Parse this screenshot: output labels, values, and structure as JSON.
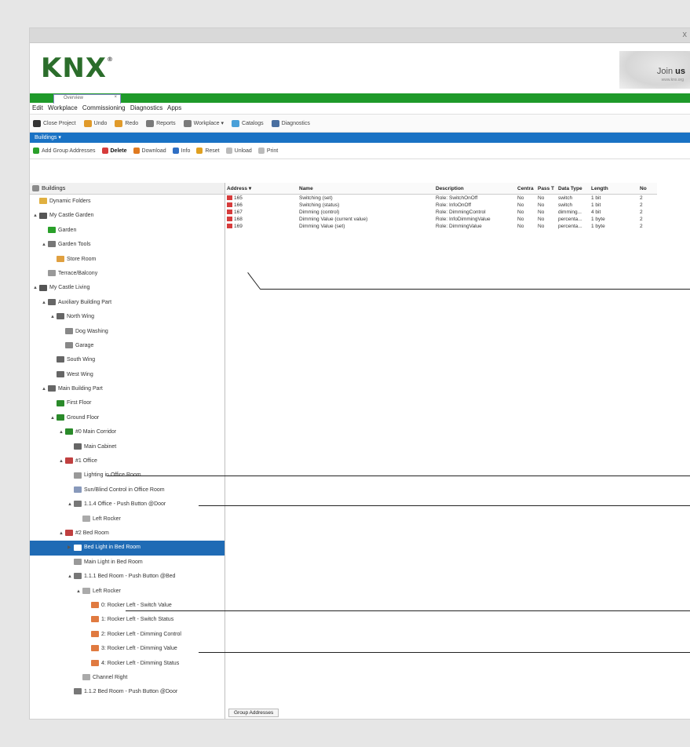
{
  "window": {
    "close": "x"
  },
  "brand": {
    "logo": "KNX",
    "reg": "®",
    "join_prefix": "Join ",
    "join_bold": "us",
    "join_url": "www.knx.org"
  },
  "tab": {
    "label": "Overview",
    "close": "×"
  },
  "menu": [
    "Edit",
    "Workplace",
    "Commissioning",
    "Diagnostics",
    "Apps"
  ],
  "toolbar": [
    {
      "label": "Close Project",
      "color": "#333333"
    },
    {
      "label": "Undo",
      "color": "#e09a2a"
    },
    {
      "label": "Redo",
      "color": "#e09a2a"
    },
    {
      "label": "Reports",
      "color": "#7a7a7a"
    },
    {
      "label": "Workplace ▾",
      "color": "#7a7a7a"
    },
    {
      "label": "Catalogs",
      "color": "#4aa0d8"
    },
    {
      "label": "Diagnostics",
      "color": "#4a6fa0"
    }
  ],
  "panel_title": "Buildings ▾",
  "actions": [
    {
      "label": "Add Group Addresses",
      "color": "#2aa02a"
    },
    {
      "label": "Delete",
      "color": "#d63c3c"
    },
    {
      "label": "Download",
      "color": "#e07a20"
    },
    {
      "label": "Info",
      "color": "#2f6fc4"
    },
    {
      "label": "Reset",
      "color": "#e0a020"
    },
    {
      "label": "Unload",
      "color": "#bbbbbb"
    },
    {
      "label": "Print",
      "color": "#bbbbbb"
    }
  ],
  "tree": {
    "header": "Buildings",
    "items": [
      {
        "label": "Dynamic Folders",
        "indent": 0,
        "toggle": "",
        "color": "#e0b040"
      },
      {
        "label": "My Castle Garden",
        "indent": 0,
        "toggle": "▲",
        "color": "#555555"
      },
      {
        "label": "Garden",
        "indent": 1,
        "toggle": "",
        "color": "#2aa02a"
      },
      {
        "label": "Garden Tools",
        "indent": 1,
        "toggle": "▲",
        "color": "#777777"
      },
      {
        "label": "Store Room",
        "indent": 2,
        "toggle": "",
        "color": "#e0a040"
      },
      {
        "label": "Terrace/Balcony",
        "indent": 1,
        "toggle": "",
        "color": "#999999"
      },
      {
        "label": "My Castle Living",
        "indent": 0,
        "toggle": "▲",
        "color": "#555555"
      },
      {
        "label": "Auxiliary Building Part",
        "indent": 1,
        "toggle": "▲",
        "color": "#666666"
      },
      {
        "label": "North Wing",
        "indent": 2,
        "toggle": "▲",
        "color": "#666666"
      },
      {
        "label": "Dog Washing",
        "indent": 3,
        "toggle": "",
        "color": "#888888"
      },
      {
        "label": "Garage",
        "indent": 3,
        "toggle": "",
        "color": "#888888"
      },
      {
        "label": "South Wing",
        "indent": 2,
        "toggle": "",
        "color": "#666666"
      },
      {
        "label": "West Wing",
        "indent": 2,
        "toggle": "",
        "color": "#666666"
      },
      {
        "label": "Main Building Part",
        "indent": 1,
        "toggle": "▲",
        "color": "#666666"
      },
      {
        "label": "First Floor",
        "indent": 2,
        "toggle": "",
        "color": "#2a8a2a"
      },
      {
        "label": "Ground Floor",
        "indent": 2,
        "toggle": "▲",
        "color": "#2a8a2a"
      },
      {
        "label": "#0 Main Corridor",
        "indent": 3,
        "toggle": "▲",
        "color": "#2a8a2a"
      },
      {
        "label": "Main Cabinet",
        "indent": 4,
        "toggle": "",
        "color": "#666666"
      },
      {
        "label": "#1 Office",
        "indent": 3,
        "toggle": "▲",
        "color": "#c04040"
      },
      {
        "label": "Lighting in Office Room",
        "indent": 4,
        "toggle": "",
        "color": "#999999"
      },
      {
        "label": "Sun/Blind Control in Office Room",
        "indent": 4,
        "toggle": "",
        "color": "#8899bb"
      },
      {
        "label": "1.1.4 Office - Push Button @Door",
        "indent": 4,
        "toggle": "▲",
        "color": "#777777"
      },
      {
        "label": "Left Rocker",
        "indent": 5,
        "toggle": "",
        "color": "#aaaaaa"
      },
      {
        "label": "#2 Bed Room",
        "indent": 3,
        "toggle": "▲",
        "color": "#c04040"
      },
      {
        "label": "Bed Light in Bed Room",
        "indent": 4,
        "toggle": "▶",
        "color": "#ffffff",
        "selected": true
      },
      {
        "label": "Main Light in Bed Room",
        "indent": 4,
        "toggle": "",
        "color": "#999999"
      },
      {
        "label": "1.1.1 Bed Room - Push Button @Bed",
        "indent": 4,
        "toggle": "▲",
        "color": "#777777"
      },
      {
        "label": "Left Rocker",
        "indent": 5,
        "toggle": "▲",
        "color": "#aaaaaa"
      },
      {
        "label": "0: Rocker Left - Switch Value",
        "indent": 6,
        "toggle": "",
        "color": "#e07a40"
      },
      {
        "label": "1: Rocker Left - Switch Status",
        "indent": 6,
        "toggle": "",
        "color": "#e07a40"
      },
      {
        "label": "2: Rocker Left - Dimming Control",
        "indent": 6,
        "toggle": "",
        "color": "#e07a40"
      },
      {
        "label": "3: Rocker Left - Dimming Value",
        "indent": 6,
        "toggle": "",
        "color": "#e07a40"
      },
      {
        "label": "4: Rocker Left - Dimming Status",
        "indent": 6,
        "toggle": "",
        "color": "#e07a40"
      },
      {
        "label": "Channel Right",
        "indent": 5,
        "toggle": "",
        "color": "#aaaaaa"
      },
      {
        "label": "1.1.2 Bed Room - Push Button @Door",
        "indent": 4,
        "toggle": "",
        "color": "#777777"
      }
    ]
  },
  "table": {
    "headers": [
      "Address ▾",
      "Name",
      "Description",
      "Centra",
      "Pass T",
      "Data Type",
      "Length",
      "No"
    ],
    "rows": [
      [
        "165",
        "Switching (set)",
        "Role: SwitchOnOff",
        "No",
        "No",
        "switch",
        "1 bit",
        "2"
      ],
      [
        "166",
        "Switching (status)",
        "Role: InfoOnOff",
        "No",
        "No",
        "switch",
        "1 bit",
        "2"
      ],
      [
        "167",
        "Dimming (control)",
        "Role: DimmingControl",
        "No",
        "No",
        "dimming...",
        "4 bit",
        "2"
      ],
      [
        "168",
        "Dimming Value (current value)",
        "Role: InfoDimmingValue",
        "No",
        "No",
        "percenta...",
        "1 byte",
        "2"
      ],
      [
        "169",
        "Dimming Value (set)",
        "Role: DimmingValue",
        "No",
        "No",
        "percenta...",
        "1 byte",
        "2"
      ]
    ]
  },
  "bottom_tab": "Group Addresses"
}
